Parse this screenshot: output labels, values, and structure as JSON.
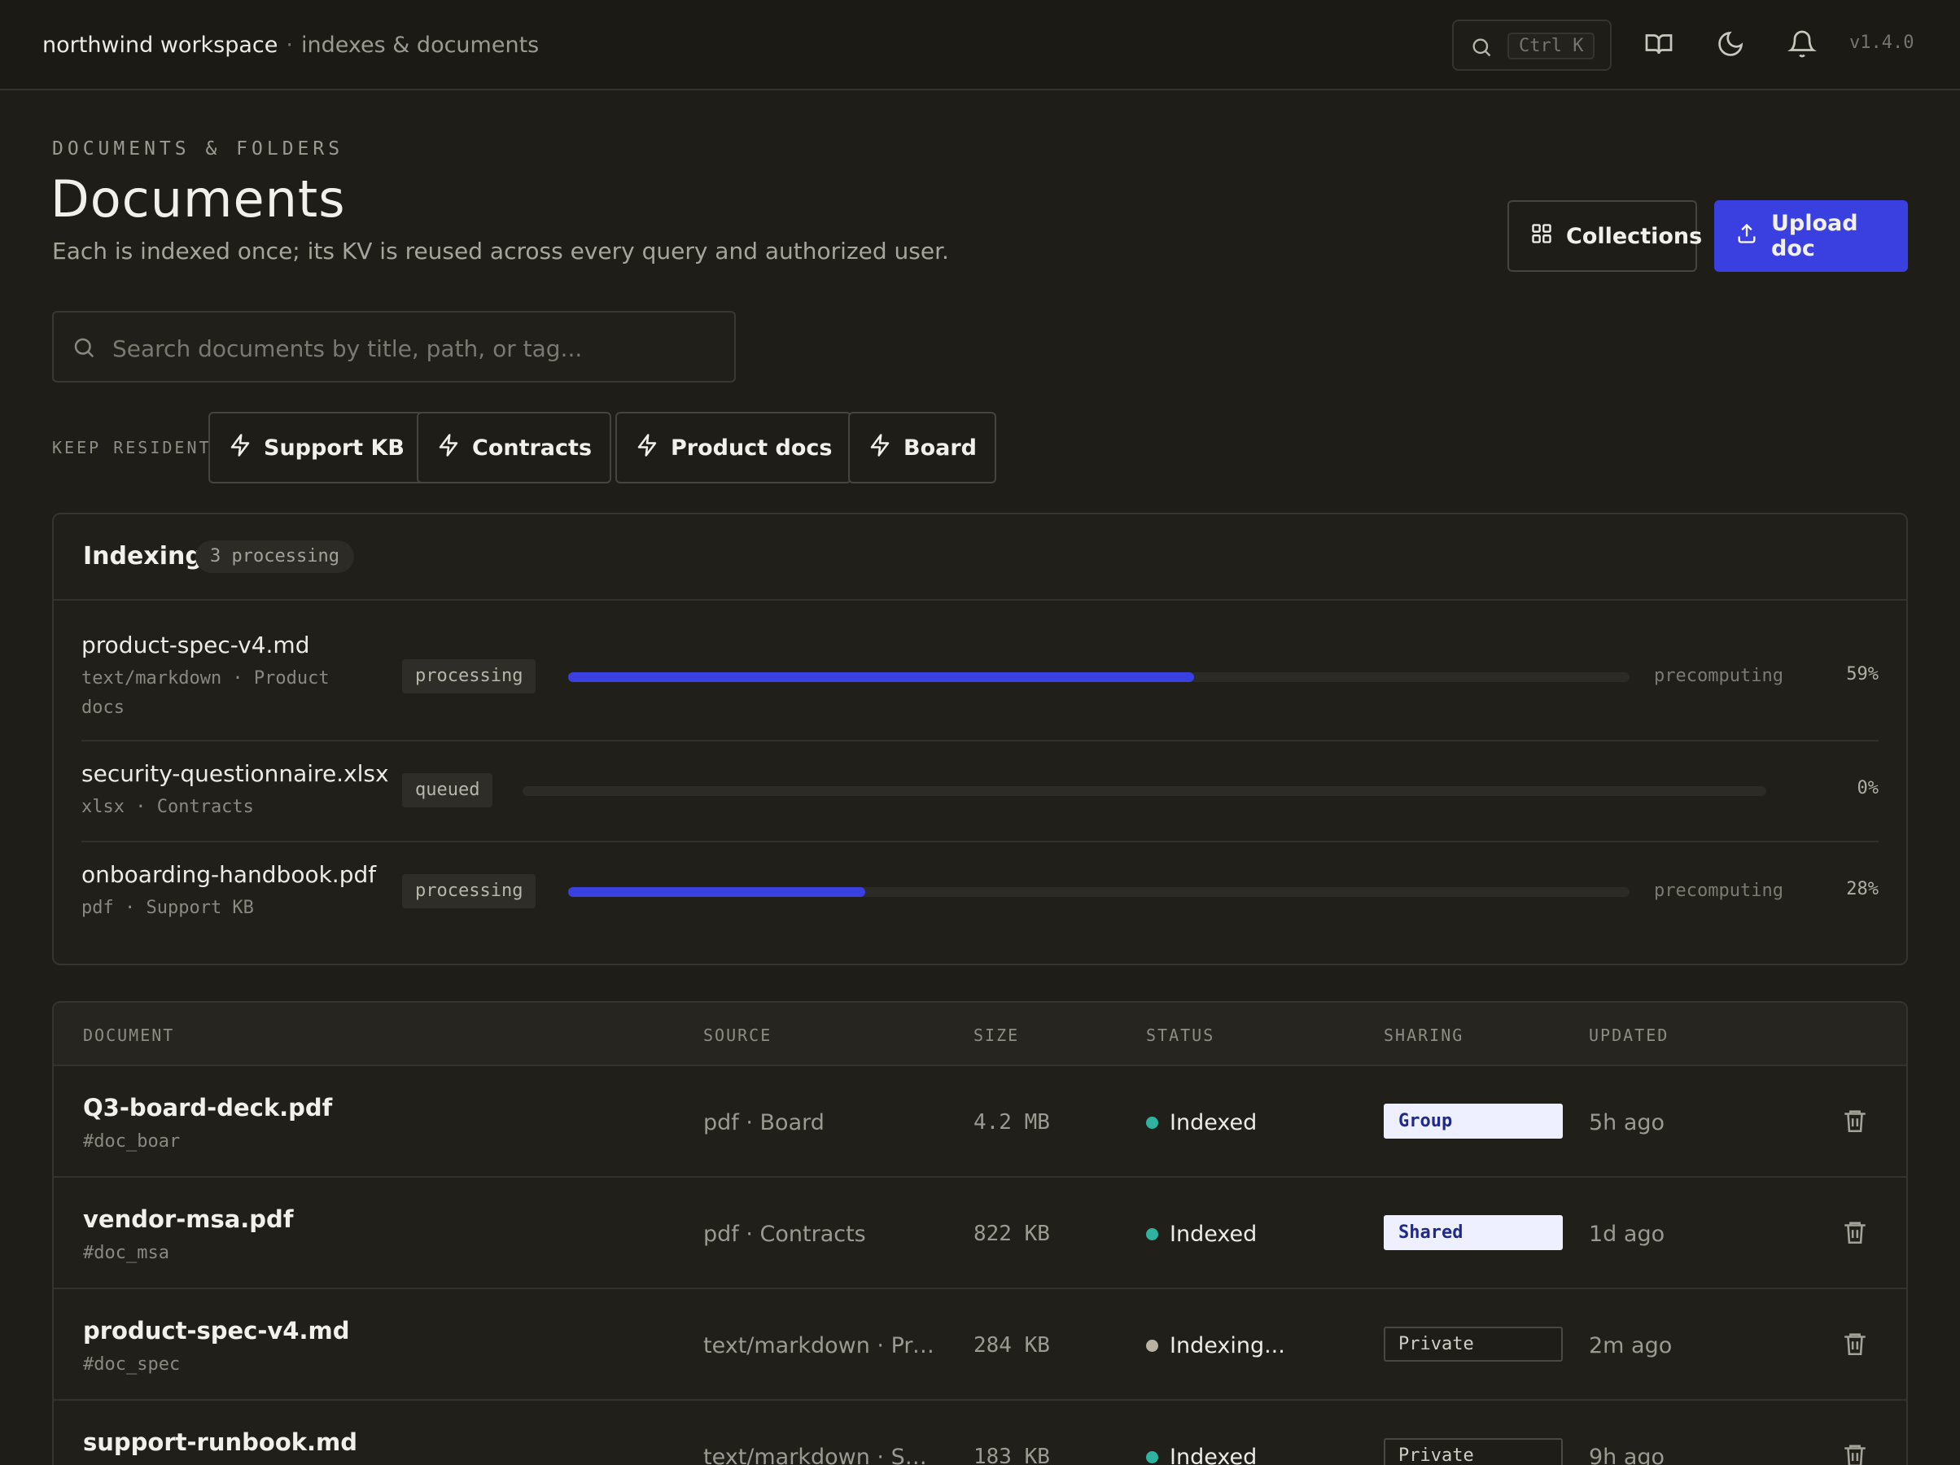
{
  "topbar": {
    "workspace": "northwind workspace",
    "separator": "·",
    "section": "indexes & documents",
    "search_shortcut": "Ctrl K",
    "version": "v1.4.0",
    "icons": [
      "search-icon",
      "book-icon",
      "moon-icon",
      "bell-icon"
    ]
  },
  "header": {
    "eyebrow": "DOCUMENTS & FOLDERS",
    "title": "Documents",
    "subtitle": "Each is indexed once; its KV is reused across every query and authorized user.",
    "collections_label": "Collections",
    "upload_label": "Upload doc"
  },
  "search": {
    "placeholder": "Search documents by title, path, or tag..."
  },
  "resident": {
    "label": "KEEP RESIDENT",
    "chips": [
      {
        "label": "Support KB"
      },
      {
        "label": "Contracts"
      },
      {
        "label": "Product docs"
      },
      {
        "label": "Board"
      }
    ]
  },
  "indexing": {
    "title": "Indexing",
    "count_label": "3 processing",
    "jobs": [
      {
        "name": "product-spec-v4.md",
        "meta": "text/markdown · Product docs",
        "status": "processing",
        "progress": 59,
        "stage": "precomputing",
        "pct_label": "59%"
      },
      {
        "name": "security-questionnaire.xlsx",
        "meta": "xlsx · Contracts",
        "status": "queued",
        "progress": 0,
        "stage": "",
        "pct_label": "0%"
      },
      {
        "name": "onboarding-handbook.pdf",
        "meta": "pdf · Support KB",
        "status": "processing",
        "progress": 28,
        "stage": "precomputing",
        "pct_label": "28%"
      }
    ]
  },
  "table": {
    "headers": {
      "document": "DOCUMENT",
      "source": "SOURCE",
      "size": "SIZE",
      "status": "STATUS",
      "sharing": "SHARING",
      "updated": "UPDATED"
    },
    "rows": [
      {
        "title": "Q3-board-deck.pdf",
        "id": "#doc_boar",
        "source": "pdf · Board",
        "size": "4.2 MB",
        "status": "Indexed",
        "status_color": "#2fb3a0",
        "sharing": "Group",
        "sharing_style": "light",
        "updated": "5h ago"
      },
      {
        "title": "vendor-msa.pdf",
        "id": "#doc_msa",
        "source": "pdf · Contracts",
        "size": "822 KB",
        "status": "Indexed",
        "status_color": "#2fb3a0",
        "sharing": "Shared",
        "sharing_style": "light",
        "updated": "1d ago"
      },
      {
        "title": "product-spec-v4.md",
        "id": "#doc_spec",
        "source": "text/markdown · Prod...",
        "size": "284 KB",
        "status": "Indexing...",
        "status_color": "#b9b3a3",
        "sharing": "Private",
        "sharing_style": "dark",
        "updated": "2m ago"
      },
      {
        "title": "support-runbook.md",
        "id": "",
        "source": "text/markdown · Supp...",
        "size": "183 KB",
        "status": "Indexed",
        "status_color": "#2fb3a0",
        "sharing": "Private",
        "sharing_style": "dark",
        "updated": "9h ago"
      }
    ]
  },
  "colors": {
    "accent": "#3a3fe0",
    "indexed": "#2fb3a0",
    "background": "#1e1d18"
  }
}
